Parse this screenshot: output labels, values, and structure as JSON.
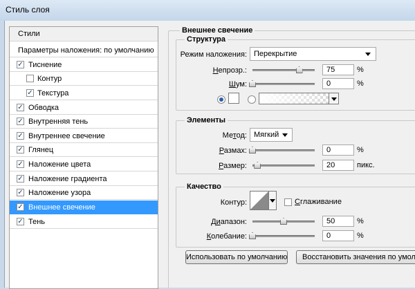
{
  "window": {
    "title": "Стиль слоя"
  },
  "sidebar": {
    "items": [
      {
        "label": "Стили",
        "checkbox": false,
        "checked": false
      },
      {
        "label": "Параметры наложения: по умолчанию",
        "checkbox": false,
        "checked": false
      },
      {
        "label": "Тиснение",
        "checkbox": true,
        "checked": true
      },
      {
        "label": "Контур",
        "checkbox": true,
        "checked": false
      },
      {
        "label": "Текстура",
        "checkbox": true,
        "checked": true
      },
      {
        "label": "Обводка",
        "checkbox": true,
        "checked": true
      },
      {
        "label": "Внутренняя тень",
        "checkbox": true,
        "checked": true
      },
      {
        "label": "Внутреннее свечение",
        "checkbox": true,
        "checked": true
      },
      {
        "label": "Глянец",
        "checkbox": true,
        "checked": true
      },
      {
        "label": "Наложение цвета",
        "checkbox": true,
        "checked": true
      },
      {
        "label": "Наложение градиента",
        "checkbox": true,
        "checked": true
      },
      {
        "label": "Наложение узора",
        "checkbox": true,
        "checked": true
      },
      {
        "label": "Внешнее свечение",
        "checkbox": true,
        "checked": true,
        "selected": true
      },
      {
        "label": "Тень",
        "checkbox": true,
        "checked": true
      }
    ]
  },
  "main": {
    "heading": "Внешнее свечение",
    "structure": {
      "title": "Структура",
      "blend_mode_label": "Режим наложения:",
      "blend_mode_value": "Перекрытие",
      "opacity_label": "Непрозр.:",
      "opacity_value": "75",
      "opacity_unit": "%",
      "opacity_level": 0.75,
      "noise_label": "Шум:",
      "noise_value": "0",
      "noise_unit": "%",
      "noise_level": 0
    },
    "elements": {
      "title": "Элементы",
      "method_label": "Метод:",
      "method_value": "Мягкий",
      "spread_label": "Размах:",
      "spread_value": "0",
      "spread_unit": "%",
      "spread_level": 0,
      "size_label": "Размер:",
      "size_value": "20",
      "size_unit": "пикс.",
      "size_level": 0.08
    },
    "quality": {
      "title": "Качество",
      "contour_label": "Контур:",
      "antialias_label": "Сглаживание",
      "antialias_checked": false,
      "range_label": "Диапазон:",
      "range_value": "50",
      "range_unit": "%",
      "range_level": 0.5,
      "jitter_label": "Колебание:",
      "jitter_value": "0",
      "jitter_unit": "%",
      "jitter_level": 0
    },
    "buttons": {
      "use_default": "Использовать по умолчанию",
      "restore_default": "Восстановить значения по умолчанию"
    }
  },
  "colors": {
    "selection": "#3399ff",
    "glow_color": "#ffffff",
    "titlebar": "#c9d9ea"
  }
}
